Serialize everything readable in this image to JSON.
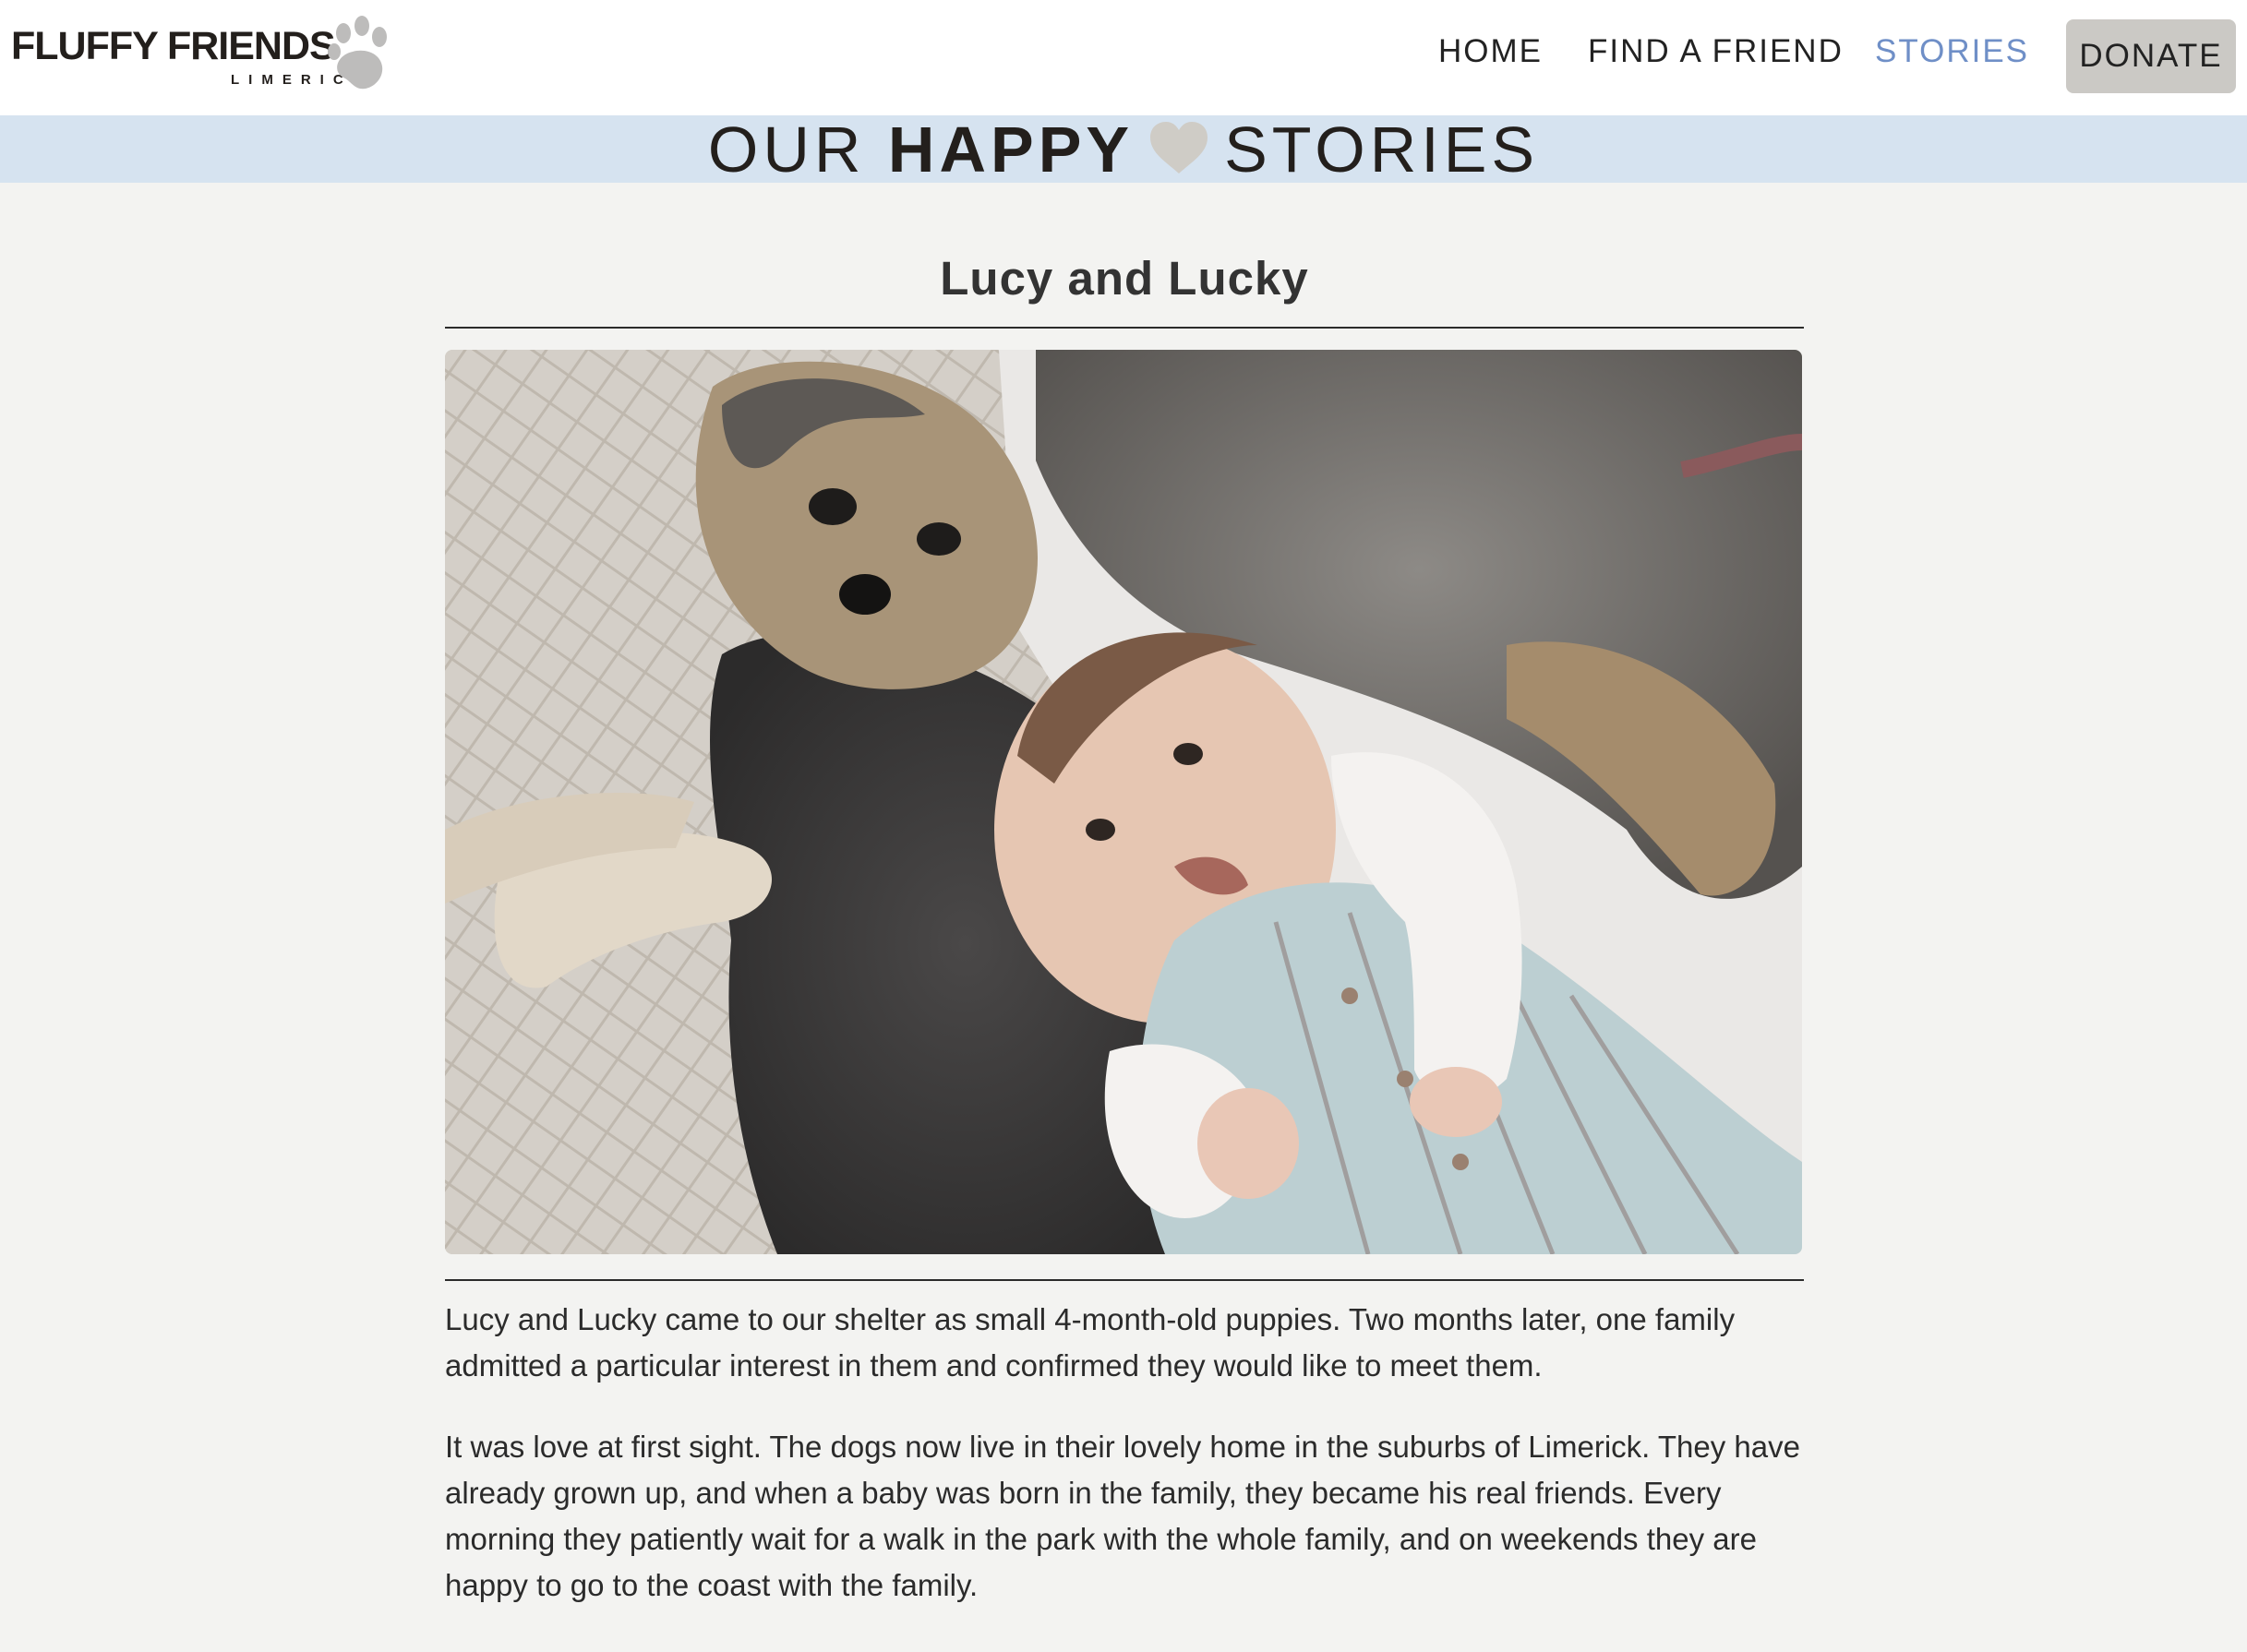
{
  "header": {
    "logo_text": "FLUFFY FRIENDS",
    "logo_subtext": "LIMERICK",
    "nav": [
      {
        "label": "HOME",
        "active": false
      },
      {
        "label": "FIND A FRIEND",
        "active": false
      },
      {
        "label": "STORIES",
        "active": true
      }
    ],
    "donate_label": "DONATE"
  },
  "banner": {
    "word1": "OUR",
    "word2": "HAPPY",
    "word3": "STORIES"
  },
  "story": {
    "title": "Lucy and Lucky",
    "paragraphs": [
      "Lucy and Lucky came to our shelter as small 4-month-old puppies. Two months later, one family admitted a particular interest in them and confirmed they would like to meet them.",
      "It was love at first sight. The dogs now live in their lovely home in the suburbs of Limerick. They have already grown up, and when a baby was born in the family, they became his real friends. Every morning they patiently wait for a walk in the park with the whole family, and on weekends they are happy to go to the coast with the family."
    ]
  },
  "colors": {
    "banner_bg": "#d6e3f0",
    "page_bg": "#f3f3f1",
    "active_nav": "#6f8fc7",
    "donate_bg": "#cbc9c5"
  }
}
